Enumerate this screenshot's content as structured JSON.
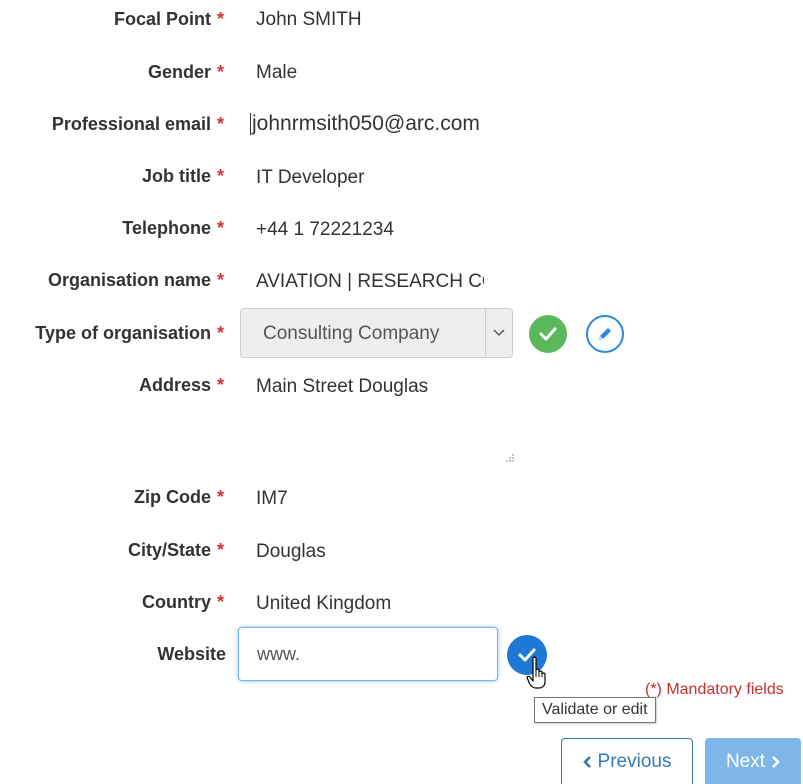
{
  "required_marker": "*",
  "colors": {
    "required": "#d9302c",
    "validate_green": "#5cb85c",
    "primary_blue": "#337ab7",
    "validate_blue": "#1e78d6",
    "next_disabled": "#7fb6ea"
  },
  "fields": {
    "focal_point": {
      "label": "Focal Point",
      "value": "John SMITH"
    },
    "gender": {
      "label": "Gender",
      "value": "Male"
    },
    "professional_email": {
      "label": "Professional email",
      "value": "johnrmsith050@arc.com"
    },
    "job_title": {
      "label": "Job title",
      "value": "IT Developer"
    },
    "telephone": {
      "label": "Telephone",
      "value": "+44 1 72221234"
    },
    "organisation_name": {
      "label": "Organisation name",
      "value": "AVIATION | RESEARCH CONSULTING"
    },
    "type_of_organisation": {
      "label": "Type of organisation",
      "selected": "Consulting Company"
    },
    "address": {
      "label": "Address",
      "value": "Main Street Douglas"
    },
    "zip_code": {
      "label": "Zip Code",
      "value": "IM7"
    },
    "city_state": {
      "label": "City/State",
      "value": "Douglas"
    },
    "country": {
      "label": "Country",
      "value": "United Kingdom"
    },
    "website": {
      "label": "Website",
      "placeholder": "www.",
      "value": ""
    }
  },
  "icons": {
    "validate": "check-icon",
    "edit": "pencil-icon",
    "dropdown": "chevron-down-icon",
    "resize": "resize-grip-icon",
    "cursor": "hand-pointer-icon",
    "prev": "chevron-left-icon",
    "next": "chevron-right-icon"
  },
  "tooltip": {
    "text": "Validate or edit"
  },
  "mandatory_note": "(*) Mandatory fields",
  "nav": {
    "previous_label": "Previous",
    "next_label": "Next"
  }
}
